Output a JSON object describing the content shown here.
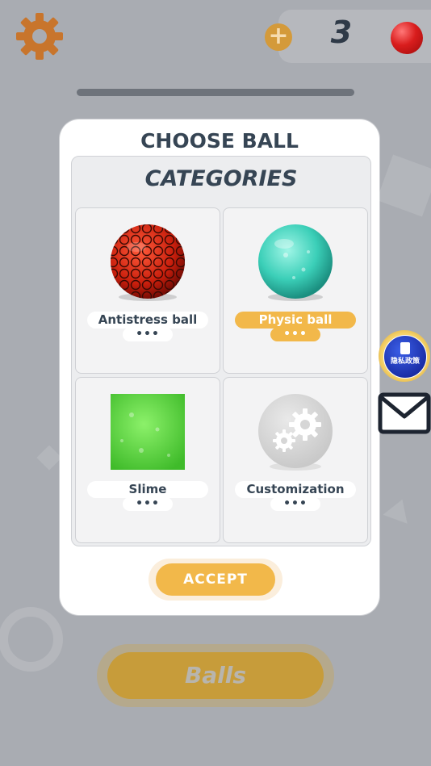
{
  "header": {
    "coin_count": "3",
    "icons": {
      "settings": "gear-icon",
      "add": "plus-icon",
      "currency": "red-ball-icon"
    }
  },
  "modal": {
    "title": "CHOOSE BALL",
    "categories_title": "CATEGORIES",
    "cards": [
      {
        "label": "Antistress ball",
        "more": "•••",
        "selected": false,
        "image": "red-antistress-ball"
      },
      {
        "label": "Physic ball",
        "more": "•••",
        "selected": true,
        "image": "teal-glass-ball"
      },
      {
        "label": "Slime",
        "more": "•••",
        "selected": false,
        "image": "green-slime-square"
      },
      {
        "label": "Customization",
        "more": "•••",
        "selected": false,
        "image": "gears-ball"
      }
    ],
    "accept_label": "ACCEPT"
  },
  "side": {
    "privacy_label": "隐私政策",
    "mail_icon": "mail-icon"
  },
  "bottom": {
    "balls_label": "Balls"
  },
  "colors": {
    "accent_orange": "#f2b84a",
    "text_dark": "#364554",
    "gear_orange": "#c8752c"
  }
}
